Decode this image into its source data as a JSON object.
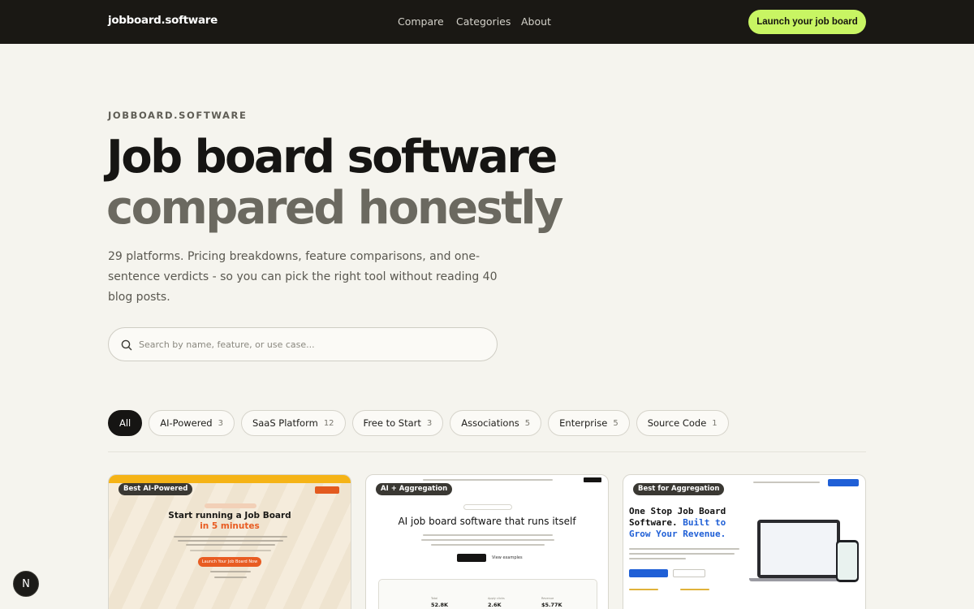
{
  "header": {
    "logo": "jobboard.software",
    "nav": [
      "Compare",
      "Categories",
      "About"
    ],
    "cta": "Launch your job board"
  },
  "hero": {
    "eyebrow": "JOBBOARD.SOFTWARE",
    "title_line1": "Job board software",
    "title_line2": "compared honestly",
    "subtitle": "29 platforms. Pricing breakdowns, feature comparisons, and one-sentence verdicts - so you can pick the right tool without reading 40 blog posts."
  },
  "search": {
    "placeholder": "Search by name, feature, or use case..."
  },
  "filters": [
    {
      "label": "All",
      "count": ""
    },
    {
      "label": "AI-Powered",
      "count": "3"
    },
    {
      "label": "SaaS Platform",
      "count": "12"
    },
    {
      "label": "Free to Start",
      "count": "3"
    },
    {
      "label": "Associations",
      "count": "5"
    },
    {
      "label": "Enterprise",
      "count": "5"
    },
    {
      "label": "Source Code",
      "count": "1"
    }
  ],
  "cards": [
    {
      "badge": "Best AI-Powered",
      "preview_title_line1": "Start running a Job Board",
      "preview_title_line2": "in 5 minutes",
      "preview_button": "Launch Your Job Board Now",
      "accent": "#e85c22"
    },
    {
      "badge": "AI + Aggregation",
      "preview_title": "AI job board software that runs itself",
      "preview_button": "Start for free",
      "preview_link": "View examples",
      "stats": [
        {
          "label": "Total",
          "value": "52.8K"
        },
        {
          "label": "Apply clicks",
          "value": "2.6K"
        },
        {
          "label": "Revenue",
          "value": "$5.77K"
        }
      ]
    },
    {
      "badge": "Best for Aggregation",
      "preview_title_line1": "One Stop Job Board",
      "preview_title_line2": "Software.",
      "preview_title_blue1": "Built to",
      "preview_title_blue2": "Grow Your Revenue.",
      "accent": "#1f5fd6"
    }
  ],
  "fab": {
    "label": "N"
  }
}
